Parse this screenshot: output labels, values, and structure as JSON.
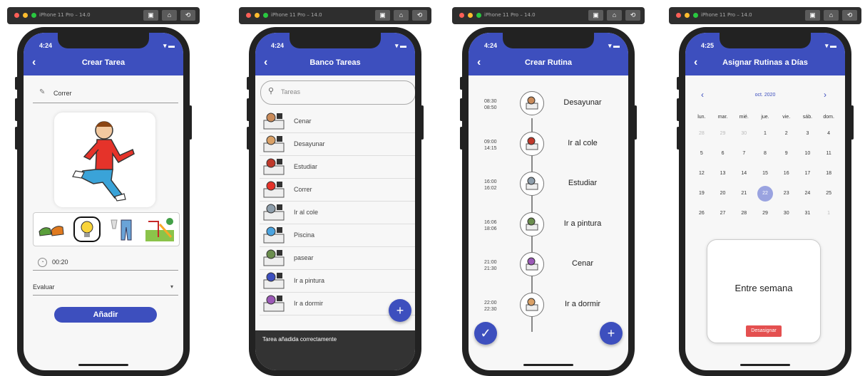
{
  "simulator": {
    "title": "iPhone 11 Pro – 14.0"
  },
  "screens": [
    {
      "time": "4:24",
      "title": "Crear Tarea",
      "back": "‹",
      "task_name": "Correr",
      "duration": "00:20",
      "evaluate": "Evaluar",
      "add_button": "Añadir"
    },
    {
      "time": "4:24",
      "title": "Banco Tareas",
      "back": "‹",
      "search_placeholder": "Tareas",
      "items": [
        "Cenar",
        "Desayunar",
        "Estudiar",
        "Correr",
        "Ir al cole",
        "Piscina",
        "pasear",
        "Ir a pintura",
        "Ir a dormir"
      ],
      "fab": "+",
      "snackbar": "Tarea añadida correctamente"
    },
    {
      "time": "4:24",
      "title": "Crear Rutina",
      "back": "‹",
      "entries": [
        {
          "start": "08:30",
          "end": "08:50",
          "name": "Desayunar"
        },
        {
          "start": "09:00",
          "end": "14:15",
          "name": "Ir al cole"
        },
        {
          "start": "16:00",
          "end": "16:02",
          "name": "Estudiar"
        },
        {
          "start": "16:06",
          "end": "18:06",
          "name": "Ir a pintura"
        },
        {
          "start": "21:00",
          "end": "21:30",
          "name": "Cenar"
        },
        {
          "start": "22:00",
          "end": "22:30",
          "name": "Ir a dormir"
        }
      ],
      "fab_check": "✓",
      "fab_add": "+"
    },
    {
      "time": "4:25",
      "title": "Asignar Rutinas a Días",
      "back": "‹",
      "month": "oct. 2020",
      "prev": "‹",
      "next": "›",
      "weekdays": [
        "lun.",
        "mar.",
        "mié.",
        "jue.",
        "vie.",
        "sáb.",
        "dom."
      ],
      "days": [
        "28",
        "29",
        "30",
        "1",
        "2",
        "3",
        "4",
        "5",
        "6",
        "7",
        "8",
        "9",
        "10",
        "11",
        "12",
        "13",
        "14",
        "15",
        "16",
        "17",
        "18",
        "19",
        "20",
        "21",
        "22",
        "23",
        "24",
        "25",
        "26",
        "27",
        "28",
        "29",
        "30",
        "31",
        "1"
      ],
      "selected_day": "22",
      "card_title": "Entre semana",
      "card_button": "Desasignar"
    }
  ],
  "colors": {
    "primary": "#3d4fbe",
    "danger": "#e45050",
    "selected": "#9aa3e0"
  }
}
